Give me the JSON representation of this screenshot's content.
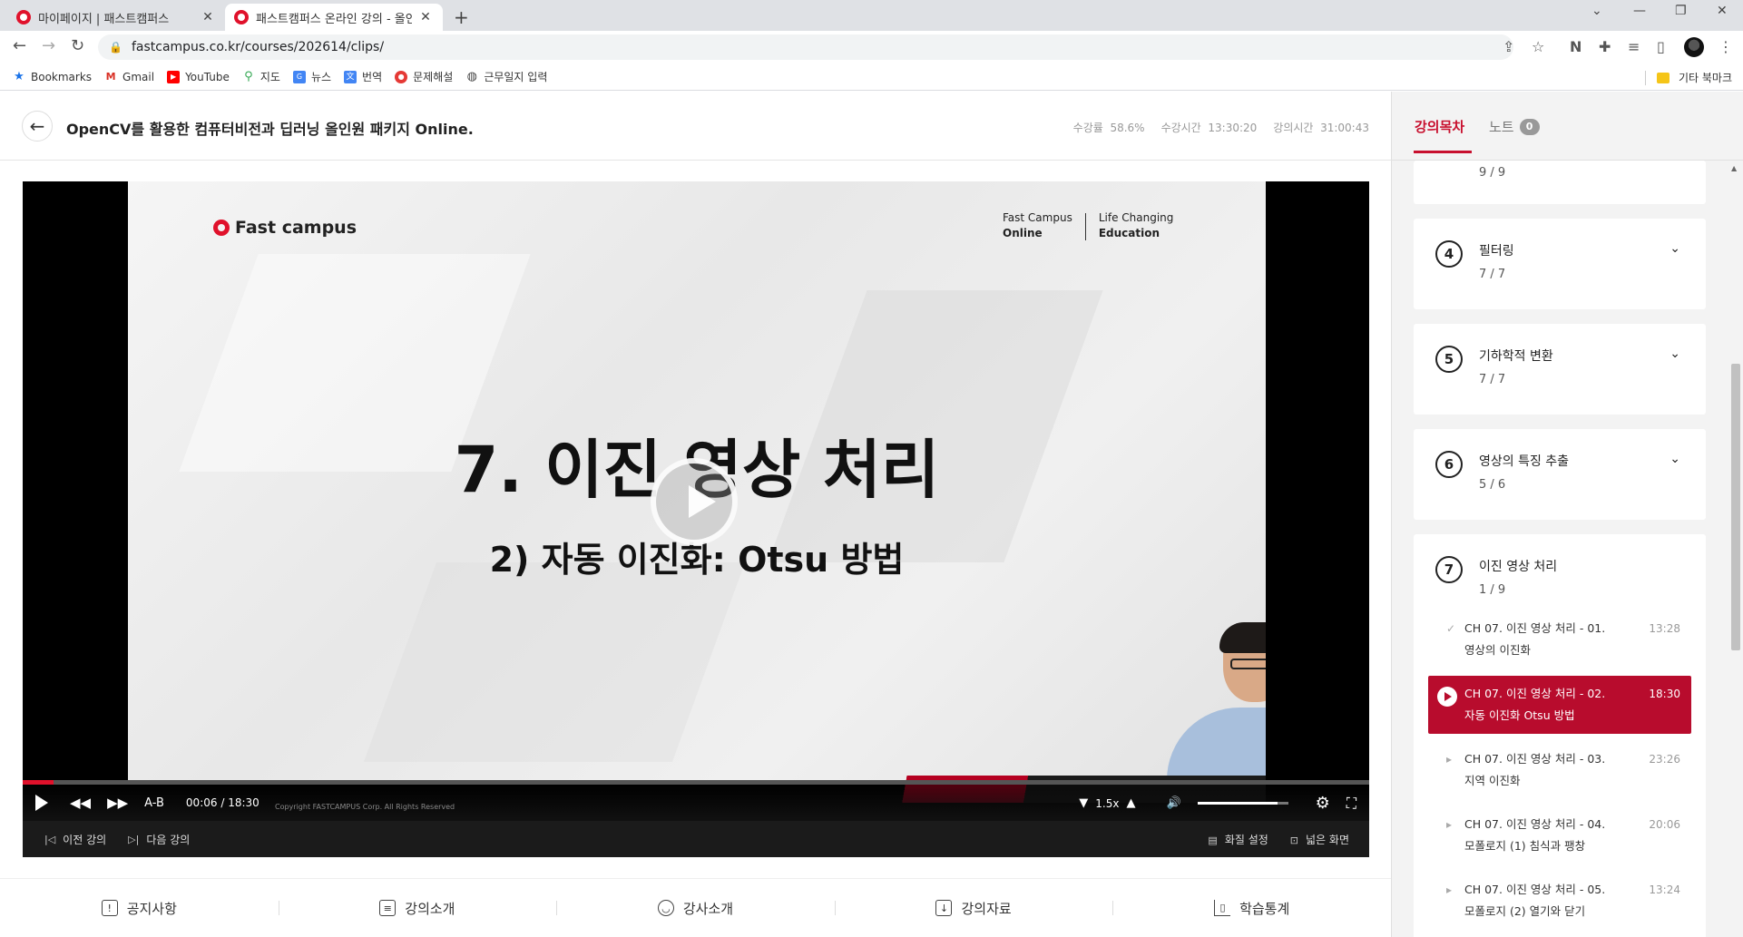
{
  "browser": {
    "tabs": [
      {
        "title": "마이페이지 | 패스트캠퍼스",
        "close": "✕"
      },
      {
        "title": "패스트캠퍼스 온라인 강의 - 올인",
        "close": "✕"
      }
    ],
    "new_tab": "+",
    "url": "fastcampus.co.kr/courses/202614/clips/",
    "bookmarks": [
      "Bookmarks",
      "Gmail",
      "YouTube",
      "지도",
      "뉴스",
      "번역",
      "문제해설",
      "근무일지 입력"
    ],
    "other_bookmarks": "기타 북마크"
  },
  "header": {
    "title": "OpenCV를 활용한 컴퓨터비전과 딥러닝 올인원 패키지 Online.",
    "stats": [
      {
        "label": "수강률",
        "value": "58.6%"
      },
      {
        "label": "수강시간",
        "value": "13:30:20"
      },
      {
        "label": "강의시간",
        "value": "31:00:43"
      }
    ]
  },
  "video": {
    "brand": "Fast campus",
    "brand_right_1a": "Fast Campus",
    "brand_right_1b": "Online",
    "brand_right_2a": "Life Changing",
    "brand_right_2b": "Education",
    "slide_title": "7. 이진 영상 처리",
    "slide_subtitle": "2) 자동 이진화: Otsu 방법",
    "ab_label": "A-B",
    "current_time": "00:06",
    "time_sep": "/",
    "duration": "18:30",
    "copyright": "Copyright FASTCAMPUS Corp. All Rights Reserved",
    "speed": "1.5x",
    "progress_fraction": 0.006,
    "volume_fraction": 0.88,
    "prev_label": "이전 강의",
    "next_label": "다음 강의",
    "quality_label": "화질 설정",
    "wide_label": "넓은 화면"
  },
  "bottom_tabs": [
    "공지사항",
    "강의소개",
    "강사소개",
    "강의자료",
    "학습통계"
  ],
  "sidebar": {
    "tab_toc": "강의목차",
    "tab_note": "노트",
    "note_count": "0",
    "sections": [
      {
        "num": "",
        "title": "",
        "progress": "9 / 9"
      },
      {
        "num": "4",
        "title": "필터링",
        "progress": "7 / 7"
      },
      {
        "num": "5",
        "title": "기하학적 변환",
        "progress": "7 / 7"
      },
      {
        "num": "6",
        "title": "영상의 특징 추출",
        "progress": "5 / 6"
      },
      {
        "num": "7",
        "title": "이진 영상 처리",
        "progress": "1 / 9"
      }
    ],
    "clips": [
      {
        "line1": "CH 07. 이진 영상 처리 - 01.",
        "line2": "영상의 이진화",
        "duration": "13:28",
        "mark": "✓"
      },
      {
        "line1": "CH 07. 이진 영상 처리 - 02.",
        "line2": "자동 이진화 Otsu 방법",
        "duration": "18:30",
        "mark": ""
      },
      {
        "line1": "CH 07. 이진 영상 처리 - 03.",
        "line2": "지역 이진화",
        "duration": "23:26",
        "mark": "▸"
      },
      {
        "line1": "CH 07. 이진 영상 처리 - 04.",
        "line2": "모폴로지 (1) 침식과 팽창",
        "duration": "20:06",
        "mark": "▸"
      },
      {
        "line1": "CH 07. 이진 영상 처리 - 05.",
        "line2": "모폴로지 (2) 열기와 닫기",
        "duration": "13:24",
        "mark": "▸"
      }
    ]
  },
  "colors": {
    "accent": "#c8102e",
    "active_clip": "#b80c2d"
  }
}
